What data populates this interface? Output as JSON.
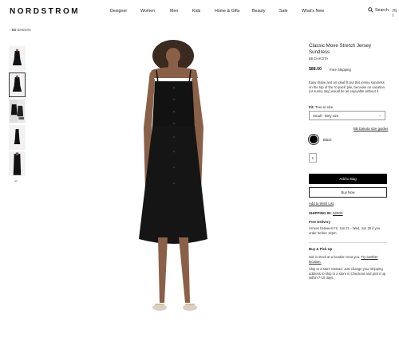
{
  "header": {
    "logo": "NORDSTROM",
    "nav": [
      "Designer",
      "Women",
      "Men",
      "Kids",
      "Home & Gifts",
      "Beauty",
      "Sale",
      "What's New"
    ],
    "search_label": "Search",
    "account_label": "Hi, I"
  },
  "breadcrumb": "BB DAKOTA",
  "product": {
    "title": "Classic Move Stretch Jersey Sundress",
    "brand": "BB DAKOTA",
    "price": "$88.00",
    "shipping": "Free Shipping",
    "description": "Easy drape and an ideal fit put this jersey sundress on the top of the 'to pack' pile, because no vacation (or sunny day) would be as enjoyable without it.",
    "fit_label": "Fit:",
    "fit_value": "True to size.",
    "size_select": "Small - Only size",
    "size_guide": "BB Dakota size guides",
    "color": "Black",
    "quantity": "1",
    "add_to_bag": "Add to Bag",
    "buy_now": "Buy Now",
    "wish_list": "Add to Wish List"
  },
  "shipping": {
    "shipping_in_label": "SHIPPING IN:",
    "zip": "92603",
    "free_delivery": "Free Delivery",
    "arrives": "Arrives between Fri, Jun 21 - Wed, Jun 26 if you order before 12pm.",
    "buy_pickup": "Buy & Pick Up",
    "not_in_stock": "Not in stock at a location near you.",
    "try_another": "Try another location.",
    "ship_to_store": "Ship to a store instead. Just change your shipping address to ship to a store in Checkout and pick it up within 7-10 days."
  },
  "colors": {
    "accent": "#000000",
    "link": "#222222"
  },
  "icons": {
    "search": "search-icon",
    "back": "chevron-left-icon",
    "thumbs_down": "chevron-down-icon",
    "size_select": "chevron-down-icon"
  }
}
